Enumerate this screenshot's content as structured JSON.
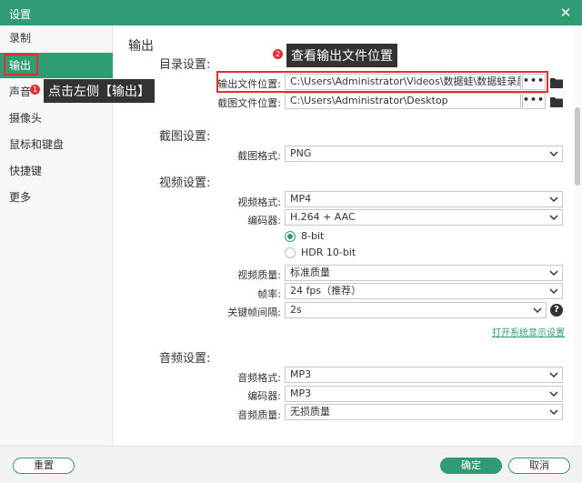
{
  "window": {
    "title": "设置",
    "close_glyph": "✕"
  },
  "sidebar": {
    "items": [
      {
        "label": "录制"
      },
      {
        "label": "输出"
      },
      {
        "label": "声音"
      },
      {
        "label": "摄像头"
      },
      {
        "label": "鼠标和键盘"
      },
      {
        "label": "快捷键"
      },
      {
        "label": "更多"
      }
    ]
  },
  "main": {
    "heading": "输出",
    "directory": {
      "title": "目录设置:",
      "output_label": "输出文件位置:",
      "output_value": "C:\\Users\\Administrator\\Videos\\数据蛙\\数据蛙录屏软件",
      "screenshot_label": "截图文件位置:",
      "screenshot_value": "C:\\Users\\Administrator\\Desktop",
      "browse_glyph": "•••"
    },
    "screenshot": {
      "title": "截图设置:",
      "format_label": "截图格式:",
      "format_value": "PNG"
    },
    "video": {
      "title": "视频设置:",
      "format_label": "视频格式:",
      "format_value": "MP4",
      "encoder_label": "编码器:",
      "encoder_value": "H.264 + AAC",
      "bit8_label": "8-bit",
      "hdr_label": "HDR 10-bit",
      "quality_label": "视频质量:",
      "quality_value": "标准质量",
      "fps_label": "帧率:",
      "fps_value": "24 fps（推荐）",
      "keyframe_label": "关键帧间隔:",
      "keyframe_value": "2s",
      "help_glyph": "?",
      "system_link": "打开系统显示设置"
    },
    "audio": {
      "title": "音频设置:",
      "format_label": "音频格式:",
      "format_value": "MP3",
      "encoder_label": "编码器:",
      "encoder_value": "MP3",
      "quality_label": "音频质量:",
      "quality_value": "无损质量"
    }
  },
  "footer": {
    "reset": "重置",
    "ok": "确定",
    "cancel": "取消"
  },
  "annotations": {
    "step1_badge": "1",
    "step1_text": "点击左侧【输出】",
    "step2_badge": "2",
    "step2_text": "查看输出文件位置"
  },
  "colors": {
    "accent": "#2f9c73",
    "highlight": "#e03131"
  }
}
